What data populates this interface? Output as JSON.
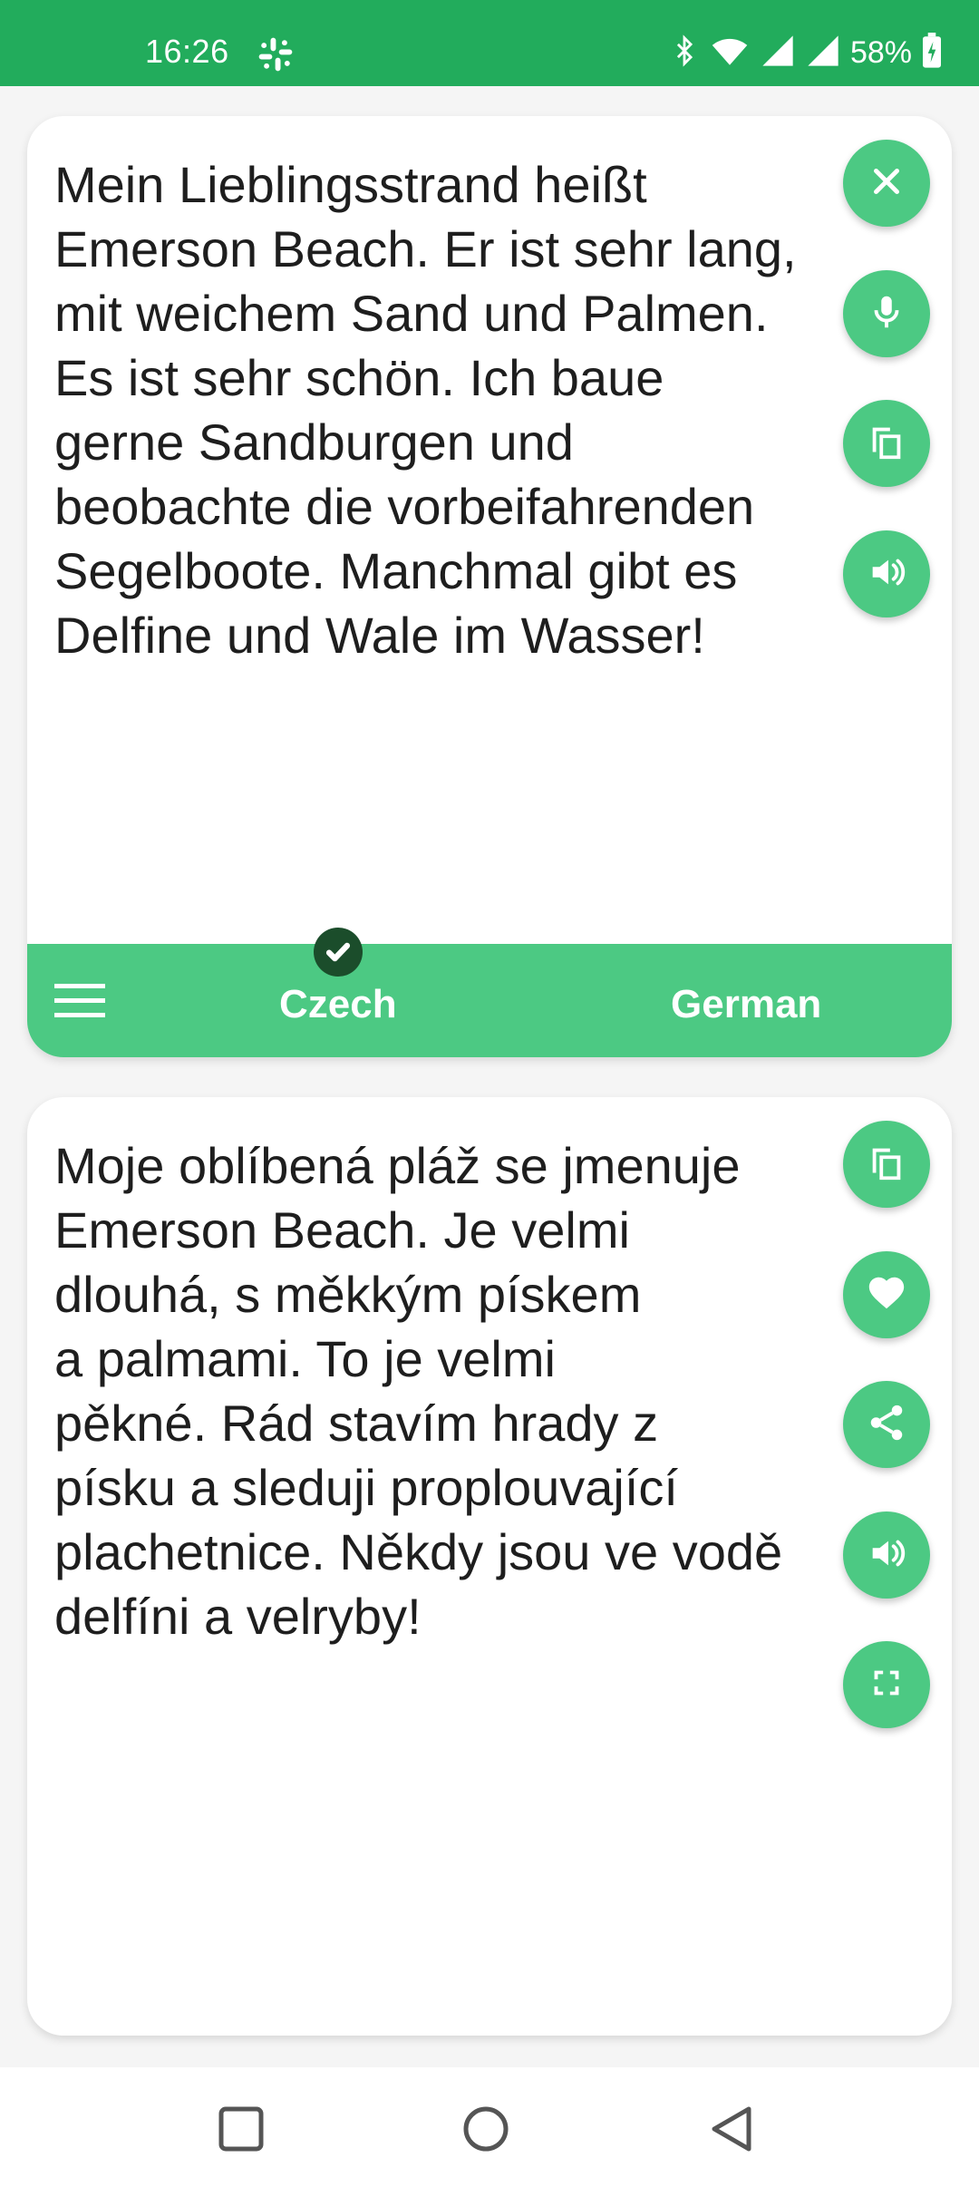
{
  "status_bar": {
    "time": "16:26",
    "app_icon": "slack-icon",
    "battery_percent": "58%",
    "icons": [
      "bluetooth-icon",
      "wifi-icon",
      "signal-icon",
      "signal-icon",
      "battery-charging-icon"
    ]
  },
  "source_panel": {
    "text": "Mein Lieblingsstrand heißt\nEmerson Beach. Er ist sehr lang,\nmit weichem Sand und Palmen.\nEs ist sehr schön. Ich baue\ngerne Sandburgen und\nbeobachte die vorbeifahrenden\nSegelboote. Manchmal gibt es\nDelfine und Wale im Wasser!",
    "actions": [
      "close-icon",
      "microphone-icon",
      "copy-icon",
      "speaker-icon"
    ]
  },
  "language_bar": {
    "source_language": "Czech",
    "target_language": "German",
    "menu_icon": "hamburger-menu-icon"
  },
  "target_panel": {
    "text": "Moje oblíbená pláž se jmenuje\nEmerson Beach. Je velmi\ndlouhá, s měkkým pískem\na palmami. To je velmi\npěkné. Rád stavím hrady z\npísku a sleduji proplouvající\nplachetnice. Někdy jsou ve vodě\ndelfíni a velryby!",
    "actions": [
      "copy-icon",
      "heart-icon",
      "share-icon",
      "speaker-icon",
      "fullscreen-icon"
    ]
  },
  "colors": {
    "status_bar": "#22ac5c",
    "accent": "#4cc983",
    "badge": "#1b4d2b"
  }
}
